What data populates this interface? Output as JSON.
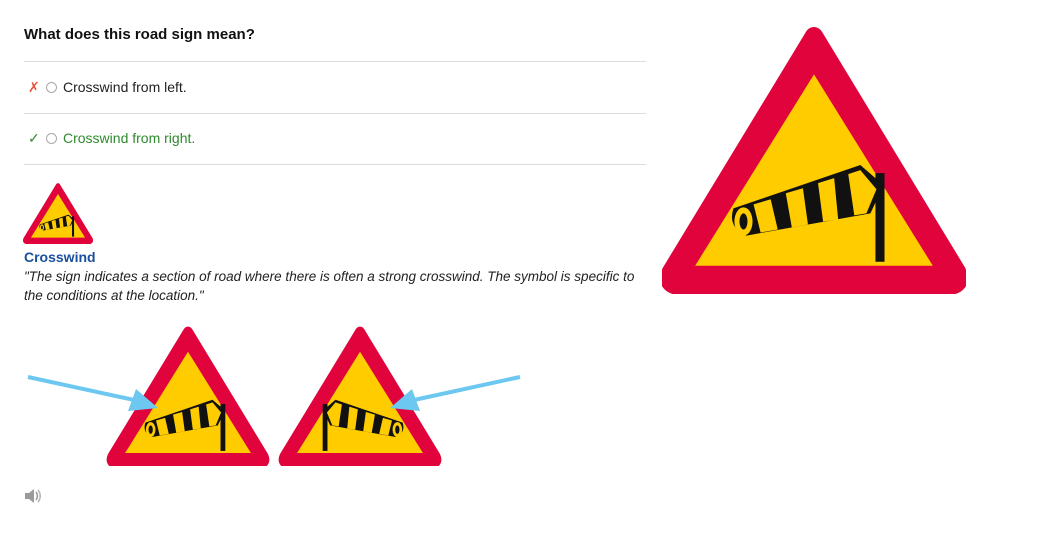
{
  "question": {
    "text": "What does this road sign mean?"
  },
  "answers": [
    {
      "mark": "✗",
      "status": "wrong",
      "label": "Crosswind from left."
    },
    {
      "mark": "✓",
      "status": "correct",
      "label": "Crosswind from right."
    }
  ],
  "explanation": {
    "title": "Crosswind",
    "text": "\"The sign indicates a section of road where there is often a strong crosswind. The symbol is specific to the conditions at the location.\""
  },
  "icons": {
    "sign": "crosswind-sign-icon",
    "audio": "speaker-icon",
    "arrow": "wind-arrow-icon"
  },
  "colors": {
    "sign_border": "#e0033c",
    "sign_fill": "#ffcc00",
    "arrow": "#6cc8f0",
    "title": "#1a4f9c",
    "correct": "#2e8b2e",
    "wrong": "#e5533d"
  }
}
